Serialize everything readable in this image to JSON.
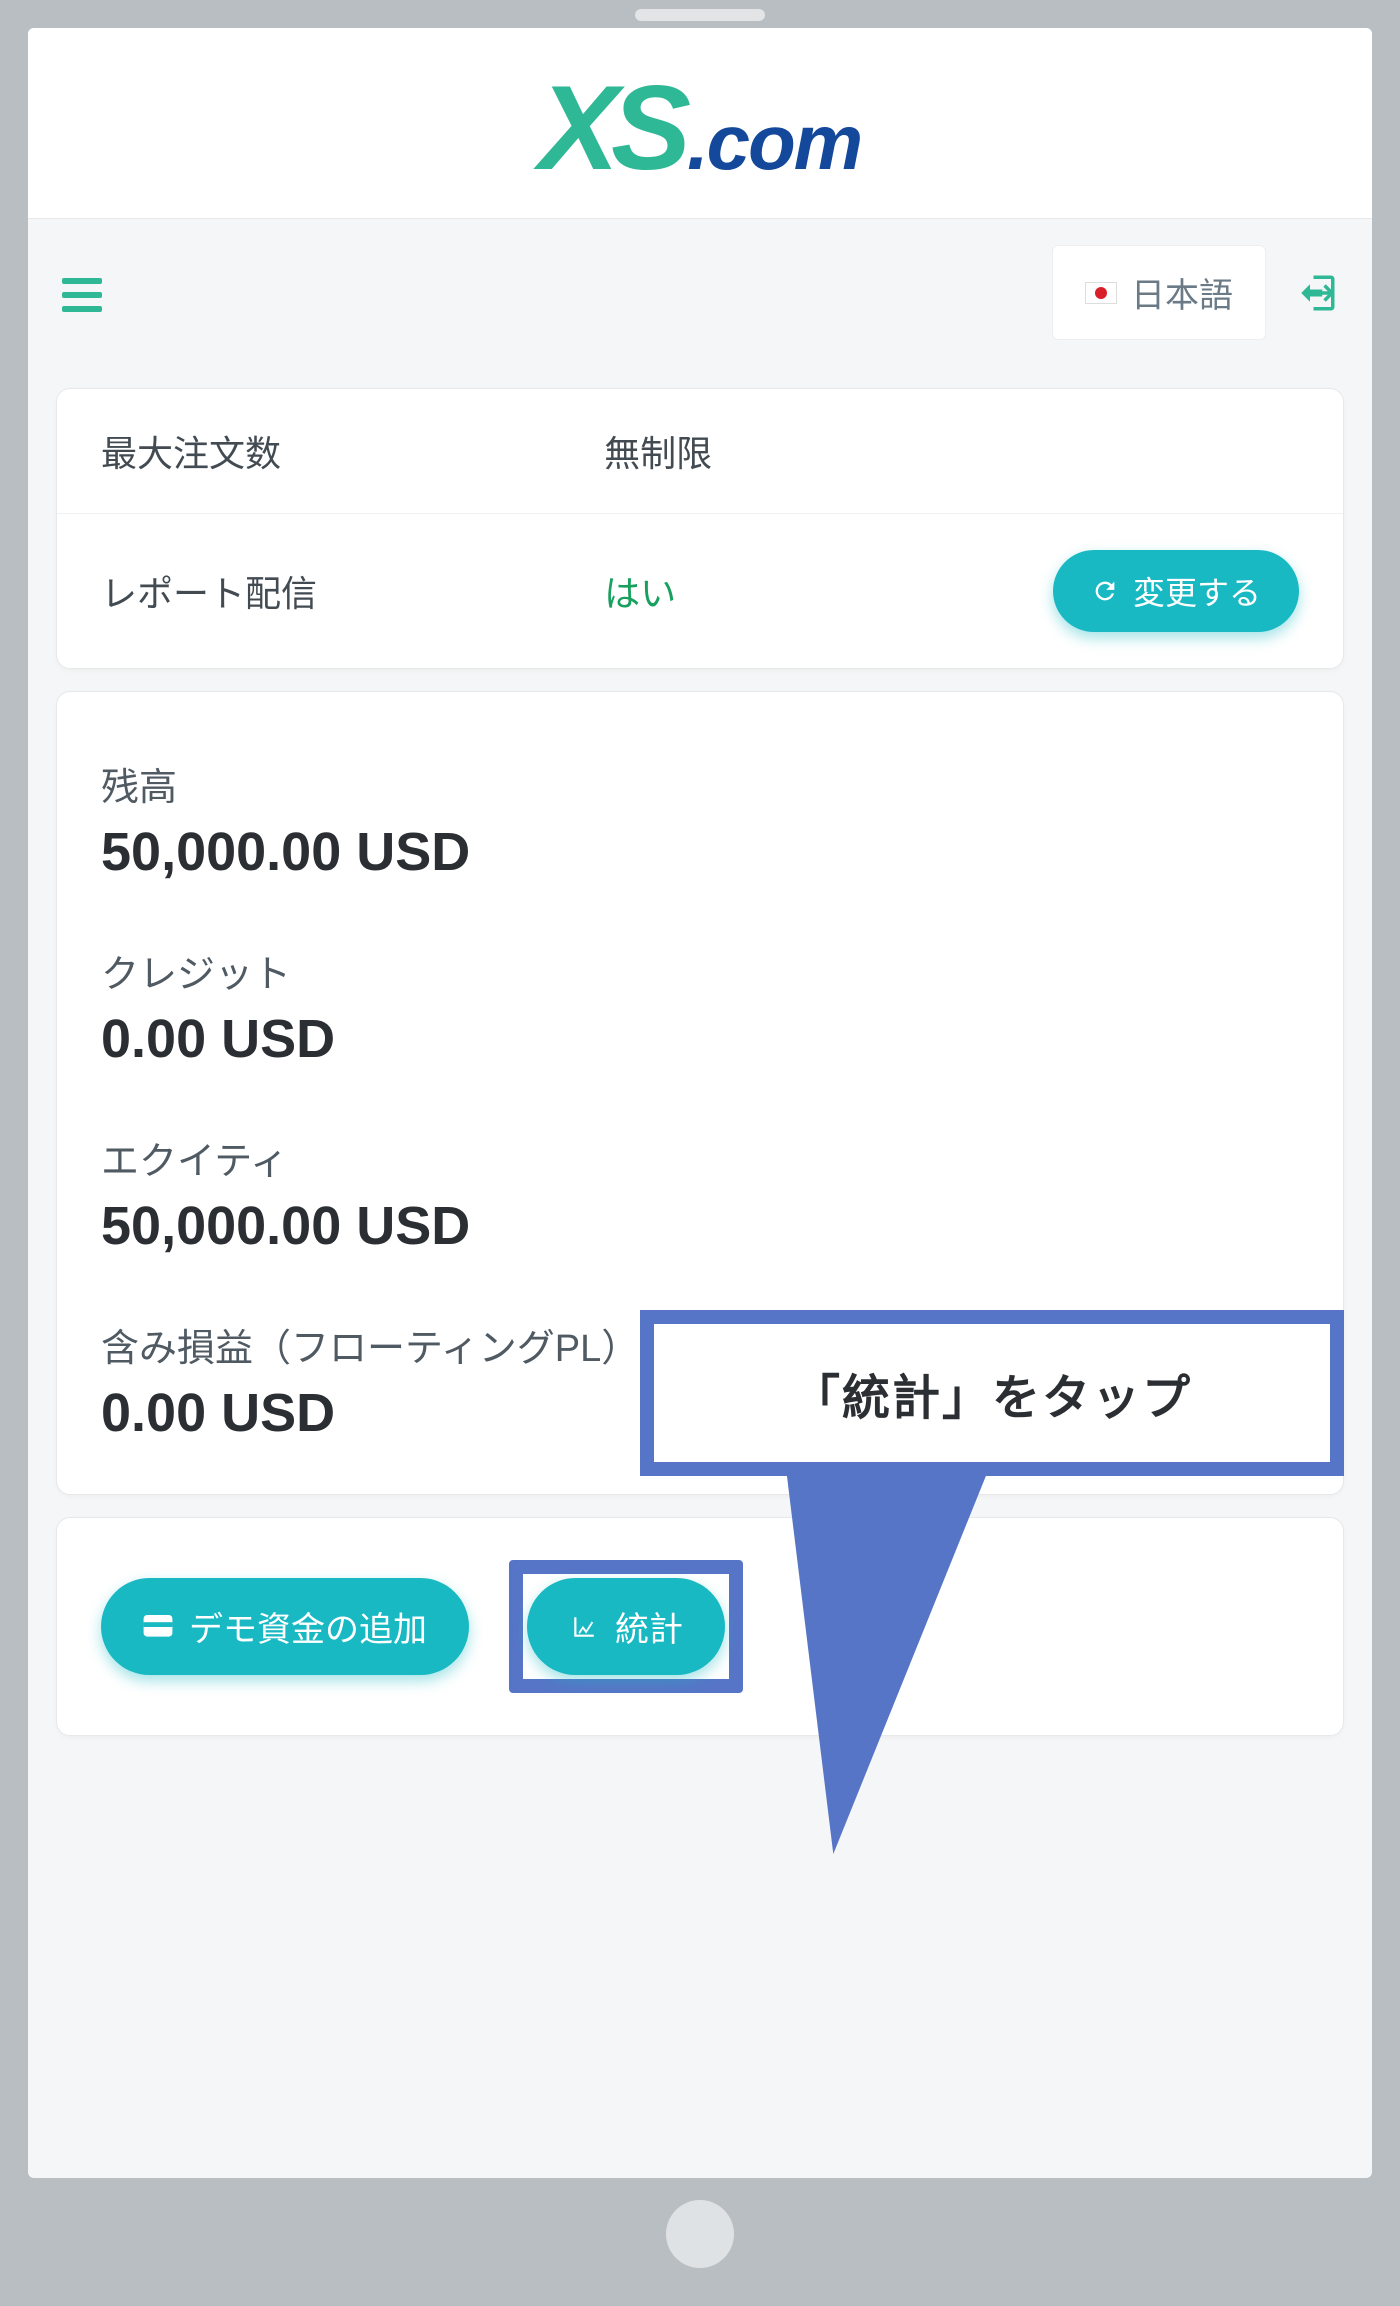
{
  "header": {
    "language": "日本語"
  },
  "settings": {
    "max_orders_label": "最大注文数",
    "max_orders_value": "無制限",
    "report_label": "レポート配信",
    "report_value": "はい",
    "change_button": "変更する"
  },
  "balances": {
    "balance_label": "残高",
    "balance_value": "50,000.00 USD",
    "credit_label": "クレジット",
    "credit_value": "0.00 USD",
    "equity_label": "エクイティ",
    "equity_value": "50,000.00 USD",
    "floating_label": "含み損益（フローティングPL）",
    "floating_value": "0.00 USD"
  },
  "actions": {
    "add_demo_funds": "デモ資金の追加",
    "statistics": "統計"
  },
  "annotation": {
    "text": "「統計」をタップ"
  },
  "colors": {
    "teal": "#19b9c4",
    "green": "#2fb895",
    "annotation_border": "#5775c6"
  }
}
